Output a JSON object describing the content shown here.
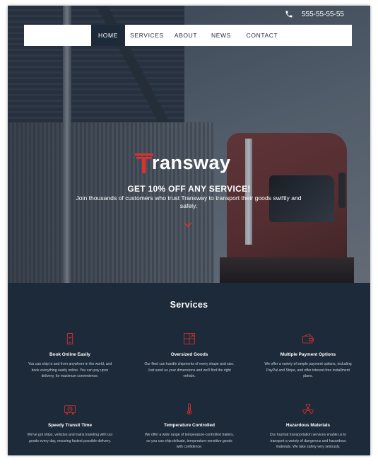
{
  "header": {
    "phone": "555-55-55-55"
  },
  "nav": {
    "items": [
      {
        "label": "HOME",
        "active": true
      },
      {
        "label": "SERVICES",
        "active": false
      },
      {
        "label": "ABOUT",
        "active": false
      },
      {
        "label": "NEWS",
        "active": false
      },
      {
        "label": "CONTACT",
        "active": false
      }
    ]
  },
  "hero": {
    "brand": "ransway",
    "promo": "GET 10% OFF ANY SERVICE!",
    "subtitle": "Join thousands of customers who trust Transway to transport their goods swiftly and safely."
  },
  "services": {
    "title": "Services",
    "items": [
      {
        "icon": "phone-icon",
        "title": "Book Online Easily",
        "desc": "You can ship to and from anywhere in the world, and book everything easily online. You can pay upon delivery, for maximum convenience."
      },
      {
        "icon": "box-size-icon",
        "title": "Oversized Goods",
        "desc": "Our fleet can handle shipments of every shape and size. Just send us your dimensions and we'll find the right vehicle."
      },
      {
        "icon": "wallet-icon",
        "title": "Multiple Payment Options",
        "desc": "We offer a variety of simple payment options, including PayPal and Stripe, and offer interest-free installment plans."
      },
      {
        "icon": "truck-clock-icon",
        "title": "Speedy Transit Time",
        "desc": "We've got ships, vehicles and trains traveling with our goods every day, ensuring fastest possible delivery."
      },
      {
        "icon": "thermometer-icon",
        "title": "Temperature Controlled",
        "desc": "We offer a wide range of temperature-controlled trailers, so you can ship delicate, temperature-sensitive goods with confidence."
      },
      {
        "icon": "hazard-icon",
        "title": "Hazardous Materials",
        "desc": "Our hazmat transportation services enable us to transport a variety of dangerous and hazardous materials. We take safety very seriously."
      }
    ]
  },
  "colors": {
    "navy": "#1d2a3a",
    "accent": "#e0302c",
    "white": "#ffffff"
  }
}
